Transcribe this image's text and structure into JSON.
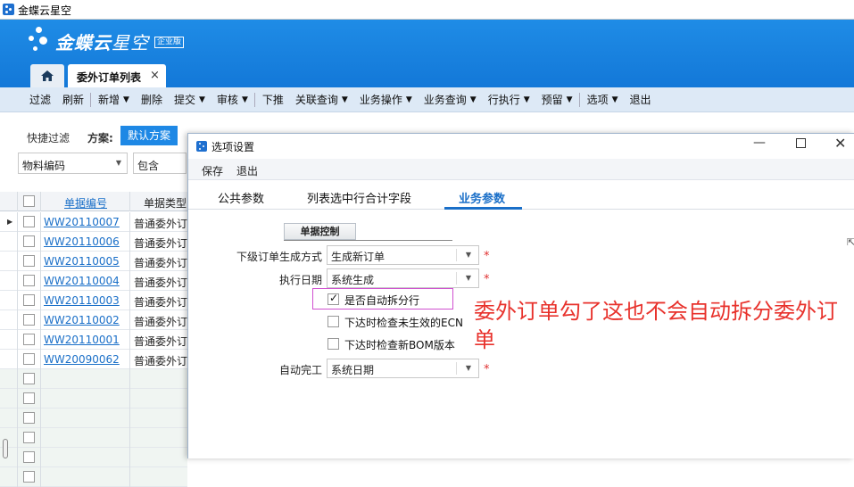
{
  "window": {
    "title": "金蝶云星空"
  },
  "header": {
    "logo_brand": "金蝶云",
    "logo_product": "星空",
    "logo_badge": "企业版",
    "tabs": [
      {
        "label": "委外订单列表"
      }
    ],
    "close_symbol": "×"
  },
  "toolbar": {
    "items": [
      {
        "label": "过滤",
        "dropdown": false
      },
      {
        "label": "刷新",
        "dropdown": false
      },
      {
        "label": "新增",
        "dropdown": true
      },
      {
        "label": "删除",
        "dropdown": false
      },
      {
        "label": "提交",
        "dropdown": true
      },
      {
        "label": "审核",
        "dropdown": true
      },
      {
        "label": "下推",
        "dropdown": false
      },
      {
        "label": "关联查询",
        "dropdown": true
      },
      {
        "label": "业务操作",
        "dropdown": true
      },
      {
        "label": "业务查询",
        "dropdown": true
      },
      {
        "label": "行执行",
        "dropdown": true
      },
      {
        "label": "预留",
        "dropdown": true
      },
      {
        "label": "选项",
        "dropdown": true
      },
      {
        "label": "退出",
        "dropdown": false
      }
    ]
  },
  "filter": {
    "quick_filter_label": "快捷过滤",
    "scheme_label": "方案:",
    "scheme_value": "默认方案",
    "field_value": "物料编码",
    "operator_value": "包含"
  },
  "grid": {
    "columns": [
      "单据编号",
      "单据类型"
    ],
    "rows": [
      {
        "doc_no": "WW20110007",
        "doc_type": "普通委外订单",
        "current": true
      },
      {
        "doc_no": "WW20110006",
        "doc_type": "普通委外订单",
        "current": false
      },
      {
        "doc_no": "WW20110005",
        "doc_type": "普通委外订单",
        "current": false
      },
      {
        "doc_no": "WW20110004",
        "doc_type": "普通委外订单",
        "current": false
      },
      {
        "doc_no": "WW20110003",
        "doc_type": "普通委外订单",
        "current": false
      },
      {
        "doc_no": "WW20110002",
        "doc_type": "普通委外订单",
        "current": false
      },
      {
        "doc_no": "WW20110001",
        "doc_type": "普通委外订单",
        "current": false
      },
      {
        "doc_no": "WW20090062",
        "doc_type": "普通委外订单",
        "current": false
      },
      {
        "doc_no": "",
        "doc_type": "",
        "current": false
      },
      {
        "doc_no": "",
        "doc_type": "",
        "current": false
      },
      {
        "doc_no": "",
        "doc_type": "",
        "current": false
      },
      {
        "doc_no": "",
        "doc_type": "",
        "current": false
      },
      {
        "doc_no": "",
        "doc_type": "",
        "current": false
      },
      {
        "doc_no": "",
        "doc_type": "",
        "current": false
      }
    ]
  },
  "dialog": {
    "title": "选项设置",
    "toolbar": {
      "save": "保存",
      "exit": "退出"
    },
    "tabs": [
      {
        "label": "公共参数",
        "active": false
      },
      {
        "label": "列表选中行合计字段",
        "active": false
      },
      {
        "label": "业务参数",
        "active": true
      }
    ],
    "section": "单据控制",
    "fields": {
      "sub_order_mode": {
        "label": "下级订单生成方式",
        "value": "生成新订单",
        "required_mark": "*"
      },
      "exec_date": {
        "label": "执行日期",
        "value": "系统生成",
        "required_mark": "*"
      },
      "auto_complete": {
        "label": "自动完工",
        "value": "系统日期",
        "required_mark": "*"
      }
    },
    "checkboxes": [
      {
        "label": "是否自动拆分行",
        "checked": true
      },
      {
        "label": "下达时检查未生效的ECN",
        "checked": false
      },
      {
        "label": "下达时检查新BOM版本",
        "checked": false
      }
    ],
    "annotation": "委外订单勾了这也不会自动拆分委外订单"
  }
}
